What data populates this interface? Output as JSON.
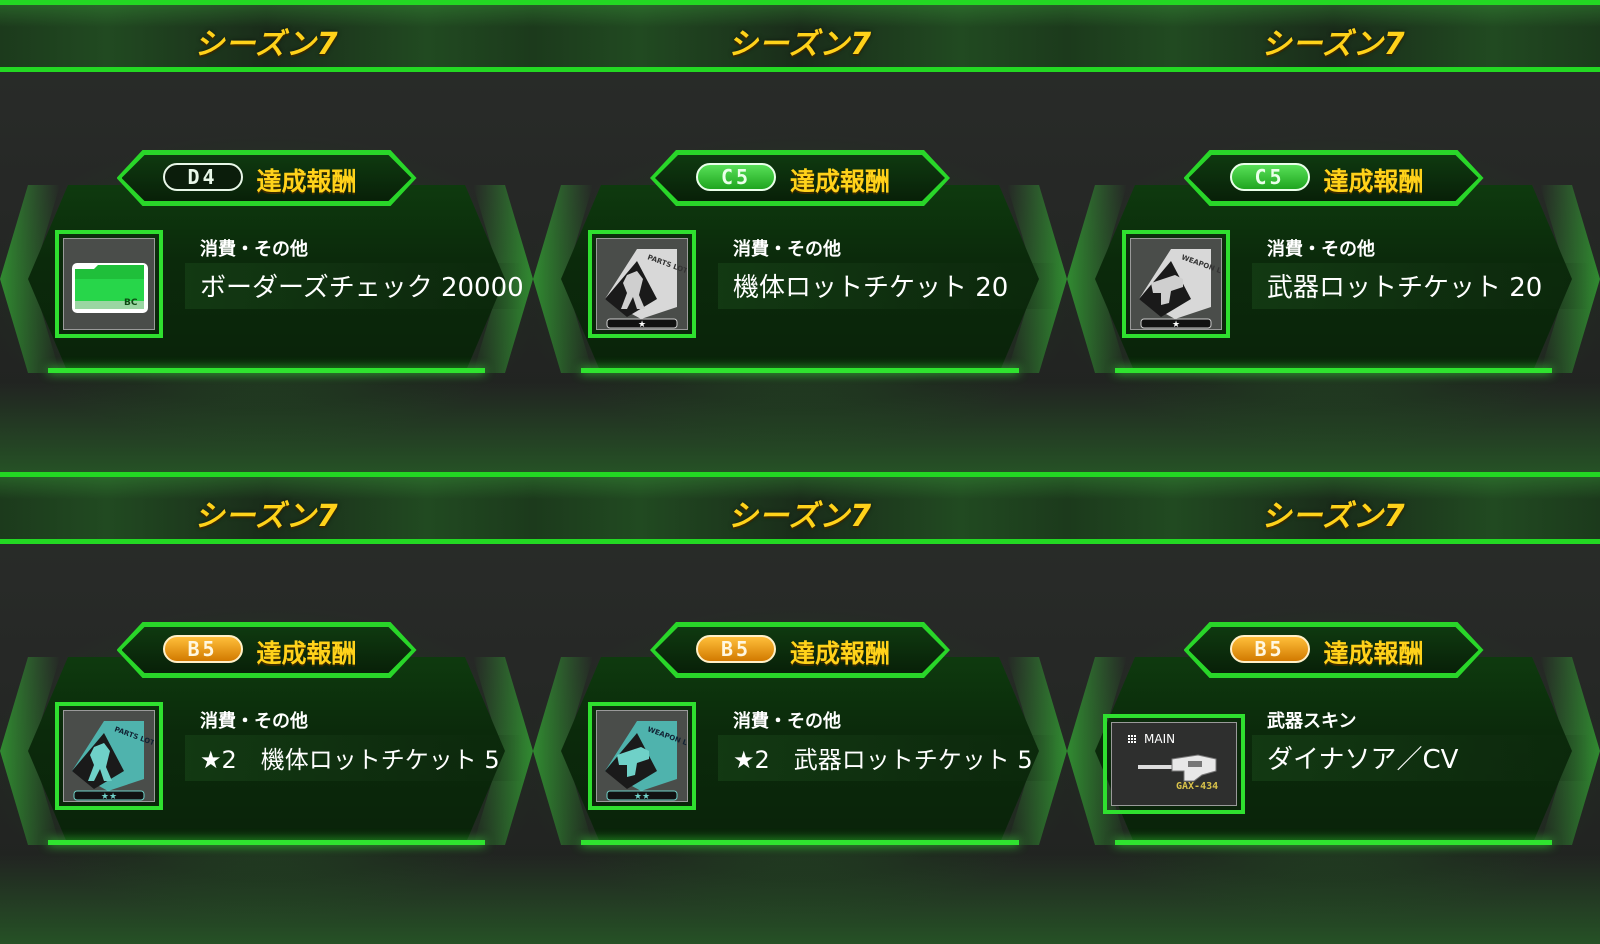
{
  "colors": {
    "accent_green": "#2fe02f",
    "title_yellow": "#ffd21a",
    "rank_orange": "#e99a10",
    "rank_green": "#35c035"
  },
  "panels": [
    {
      "season_title": "シーズン7",
      "rank": "D4",
      "rank_style": "dark",
      "achievement_label": "達成報酬",
      "item_category": "消費・その他",
      "item_name": "ボーダーズチェック 20000",
      "icon": "border-check-card-icon"
    },
    {
      "season_title": "シーズン7",
      "rank": "C5",
      "rank_style": "green",
      "achievement_label": "達成報酬",
      "item_category": "消費・その他",
      "item_name": "機体ロットチケット 20",
      "icon": "parts-lotto-ticket-icon",
      "icon_text": "PARTS LOTTO",
      "stars": "★"
    },
    {
      "season_title": "シーズン7",
      "rank": "C5",
      "rank_style": "green",
      "achievement_label": "達成報酬",
      "item_category": "消費・その他",
      "item_name": "武器ロットチケット 20",
      "icon": "weapon-lotto-ticket-icon",
      "icon_text": "WEAPON LOTTO",
      "stars": "★"
    },
    {
      "season_title": "シーズン7",
      "rank": "B5",
      "rank_style": "orange",
      "achievement_label": "達成報酬",
      "item_category": "消費・その他",
      "item_name": "★2　機体ロットチケット 5",
      "icon": "parts-lotto-ticket-icon",
      "icon_text": "PARTS LOTTO",
      "stars": "★★"
    },
    {
      "season_title": "シーズン7",
      "rank": "B5",
      "rank_style": "orange",
      "achievement_label": "達成報酬",
      "item_category": "消費・その他",
      "item_name": "★2　武器ロットチケット 5",
      "icon": "weapon-lotto-ticket-icon",
      "icon_text": "WEAPON LOTTO",
      "stars": "★★"
    },
    {
      "season_title": "シーズン7",
      "rank": "B5",
      "rank_style": "orange",
      "achievement_label": "達成報酬",
      "item_category": "武器スキン",
      "item_name": "ダイナソア／CV",
      "icon": "weapon-skin-icon",
      "icon_slot": "MAIN",
      "icon_weapon_code": "GAX-434"
    }
  ]
}
